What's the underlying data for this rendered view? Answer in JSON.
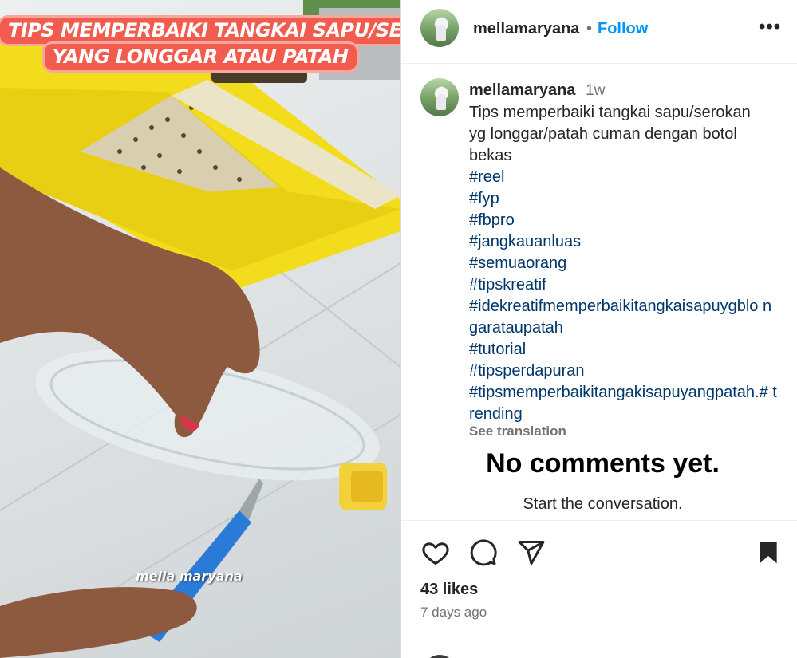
{
  "media": {
    "overlay_line1": "TIPS MEMPERBAIKI TANGKAI SAPU/SEROKAN",
    "overlay_line2": "YANG LONGGAR ATAU PATAH",
    "watermark": "mella maryana"
  },
  "header": {
    "username": "mellamaryana",
    "separator": "•",
    "follow_label": "Follow",
    "more_icon": "more-horizontal-icon",
    "more_label": "•••"
  },
  "post": {
    "username": "mellamaryana",
    "time": "1w",
    "caption_lines": [
      "Tips memperbaiki tangkai sapu/serokan",
      "yg longgar/patah cuman dengan botol",
      "bekas"
    ],
    "hashtags": [
      "#reel",
      "#fyp",
      "#fbpro",
      "#jangkauanluas",
      "#semuaorang",
      "#tipskreatif",
      "#idekreatifmemperbaikitangkaisapuygblo ngarataupatah",
      "#tutorial",
      "#tipsperdapuran",
      "#tipsmemperbaikitangakisapuyangpatah.# trending"
    ],
    "see_translation": "See translation"
  },
  "comments": {
    "empty_title": "No comments yet.",
    "empty_subtitle": "Start the conversation."
  },
  "actions": {
    "icons": [
      "heart-icon",
      "comment-icon",
      "share-icon",
      "bookmark-icon"
    ],
    "likes": "43 likes",
    "posted_ago": "7 days ago"
  }
}
